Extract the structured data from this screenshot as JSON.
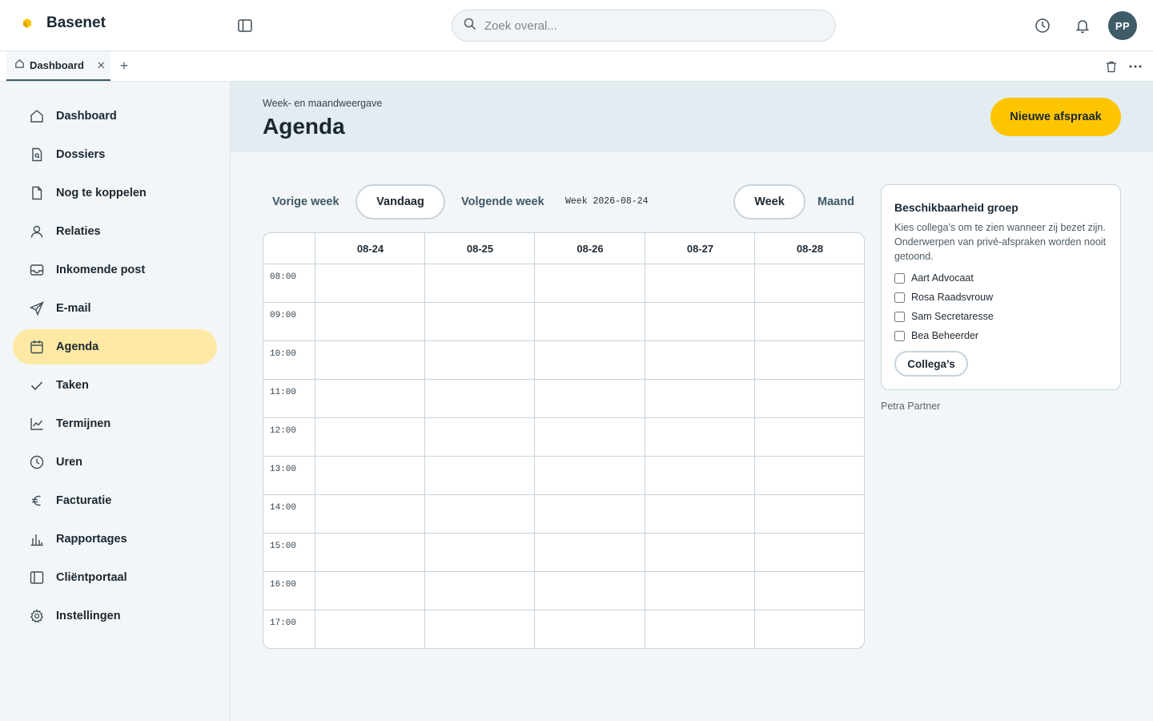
{
  "app": {
    "name": "Basenet"
  },
  "search": {
    "placeholder": "Zoek overal..."
  },
  "user": {
    "initials": "PP",
    "name": "Petra Partner"
  },
  "tabs": [
    {
      "label": "Dashboard",
      "icon": "home-icon"
    }
  ],
  "sidebar": {
    "items": [
      {
        "label": "Dashboard",
        "icon": "home-icon"
      },
      {
        "label": "Dossiers",
        "icon": "file-icon"
      },
      {
        "label": "Nog te koppelen",
        "icon": "file-outline-icon"
      },
      {
        "label": "Relaties",
        "icon": "user-icon"
      },
      {
        "label": "Inkomende post",
        "icon": "inbox-icon"
      },
      {
        "label": "E-mail",
        "icon": "send-icon"
      },
      {
        "label": "Agenda",
        "icon": "calendar-icon",
        "active": true
      },
      {
        "label": "Taken",
        "icon": "check-icon"
      },
      {
        "label": "Termijnen",
        "icon": "chart-line-icon"
      },
      {
        "label": "Uren",
        "icon": "clock-icon"
      },
      {
        "label": "Facturatie",
        "icon": "euro-icon"
      },
      {
        "label": "Rapportages",
        "icon": "bar-chart-icon"
      },
      {
        "label": "Cliëntportaal",
        "icon": "portal-icon"
      },
      {
        "label": "Instellingen",
        "icon": "gear-icon"
      }
    ]
  },
  "header": {
    "eyebrow": "Week- en maandweergave",
    "title": "Agenda",
    "primary_action": "Nieuwe afspraak"
  },
  "calendar": {
    "prev_label": "Vorige week",
    "today_label": "Vandaag",
    "next_label": "Volgende week",
    "week_label": "Week 2026-08-24",
    "view_week": "Week",
    "view_month": "Maand",
    "days": [
      "08-24",
      "08-25",
      "08-26",
      "08-27",
      "08-28"
    ],
    "hours": [
      "08:00",
      "09:00",
      "10:00",
      "11:00",
      "12:00",
      "13:00",
      "14:00",
      "15:00",
      "16:00",
      "17:00"
    ]
  },
  "availability": {
    "title": "Beschikbaarheid groep",
    "description": "Kies collega’s om te zien wanneer zij bezet zijn. Onderwerpen van privé-afspraken worden nooit getoond.",
    "colleagues": [
      "Aart Advocaat",
      "Rosa Raadsvrouw",
      "Sam Secretaresse",
      "Bea Beheerder"
    ],
    "button": "Collega’s"
  },
  "colors": {
    "accent": "#fdc500",
    "active_nav": "#fde9a3",
    "header_bg": "#e2ecf1",
    "avatar": "#3f5b68"
  }
}
